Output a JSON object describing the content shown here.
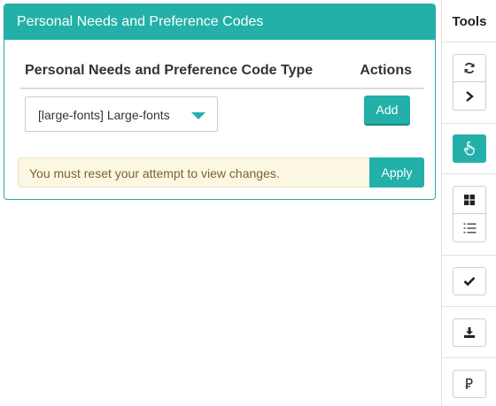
{
  "panel": {
    "title": "Personal Needs and Preference Codes",
    "columns": {
      "type": "Personal Needs and Preference Code Type",
      "actions": "Actions"
    },
    "select": {
      "value": "[large-fonts] Large-fonts"
    },
    "add_label": "Add",
    "notice": "You must reset your attempt to view changes.",
    "apply_label": "Apply"
  },
  "tools": {
    "title": "Tools",
    "buttons": [
      {
        "name": "refresh-icon"
      },
      {
        "name": "chevron-right-icon"
      },
      {
        "name": "pointer-hand-icon",
        "active": true
      },
      {
        "name": "grid-icon"
      },
      {
        "name": "numbered-list-icon"
      },
      {
        "name": "check-icon"
      },
      {
        "name": "download-icon"
      },
      {
        "name": "p-icon"
      }
    ]
  },
  "colors": {
    "accent": "#22b0a9",
    "notice_bg": "#fcf7e3",
    "notice_text": "#7a6431"
  }
}
